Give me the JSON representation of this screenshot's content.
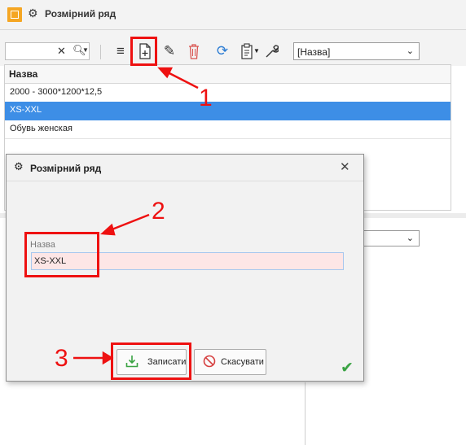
{
  "window": {
    "title": "Розмірний ряд"
  },
  "toolbar": {
    "search_value": "",
    "sort_select_value": "[Назва]"
  },
  "grid": {
    "column_header": "Назва",
    "rows": [
      {
        "name": "2000 - 3000*1200*12,5",
        "selected": false
      },
      {
        "name": "XS-XXL",
        "selected": true
      },
      {
        "name": "Обувь женская",
        "selected": false
      }
    ]
  },
  "dialog": {
    "title": "Розмірний ряд",
    "field_label": "Назва",
    "field_value": "XS-XXL",
    "save_label": "Записати",
    "cancel_label": "Скасувати"
  },
  "annotations": {
    "step1": "1",
    "step2": "2",
    "step3": "3"
  },
  "colors": {
    "accent": "#3d8ee6",
    "annotation_red": "#ee1111",
    "invalid_field_bg": "#fde6e6",
    "success_green": "#3aa343"
  },
  "icons": [
    "app-logo",
    "gear-icon",
    "clear-icon",
    "search-icon",
    "filter-icon",
    "add-document-icon",
    "edit-icon",
    "delete-icon",
    "refresh-icon",
    "clipboard-icon",
    "wrench-icon",
    "close-icon",
    "save-icon",
    "cancel-icon",
    "check-icon"
  ]
}
